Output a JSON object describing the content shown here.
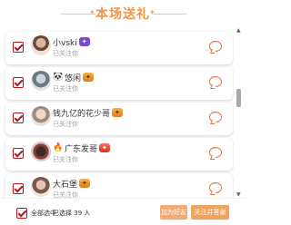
{
  "header": {
    "title": "本场送礼"
  },
  "list": {
    "items": [
      {
        "name": "小vski",
        "badge": "",
        "pet": "",
        "status": "已关注你"
      },
      {
        "name": "悠闲",
        "badge": "",
        "pet": "",
        "status": "已关注你"
      },
      {
        "name": "钱九亿的花少哥",
        "badge": "",
        "pet": "",
        "status": "已关注你"
      },
      {
        "name": "广东发哥",
        "badge": "",
        "pet": "",
        "status": "已关注你"
      },
      {
        "name": "大石堡",
        "badge": "",
        "pet": "",
        "status": "已关注你"
      }
    ]
  },
  "footer": {
    "select_all": "全部选中",
    "selected_prefix": "已选择",
    "selected_count": "39",
    "selected_suffix": "人",
    "button_secondary": "加为好友",
    "button_primary": "关注并答谢"
  },
  "colors": {
    "title": "#f29345",
    "checkbox": "#b2181c",
    "button": "#f0a35e",
    "chat_icon": "#e8733d"
  }
}
